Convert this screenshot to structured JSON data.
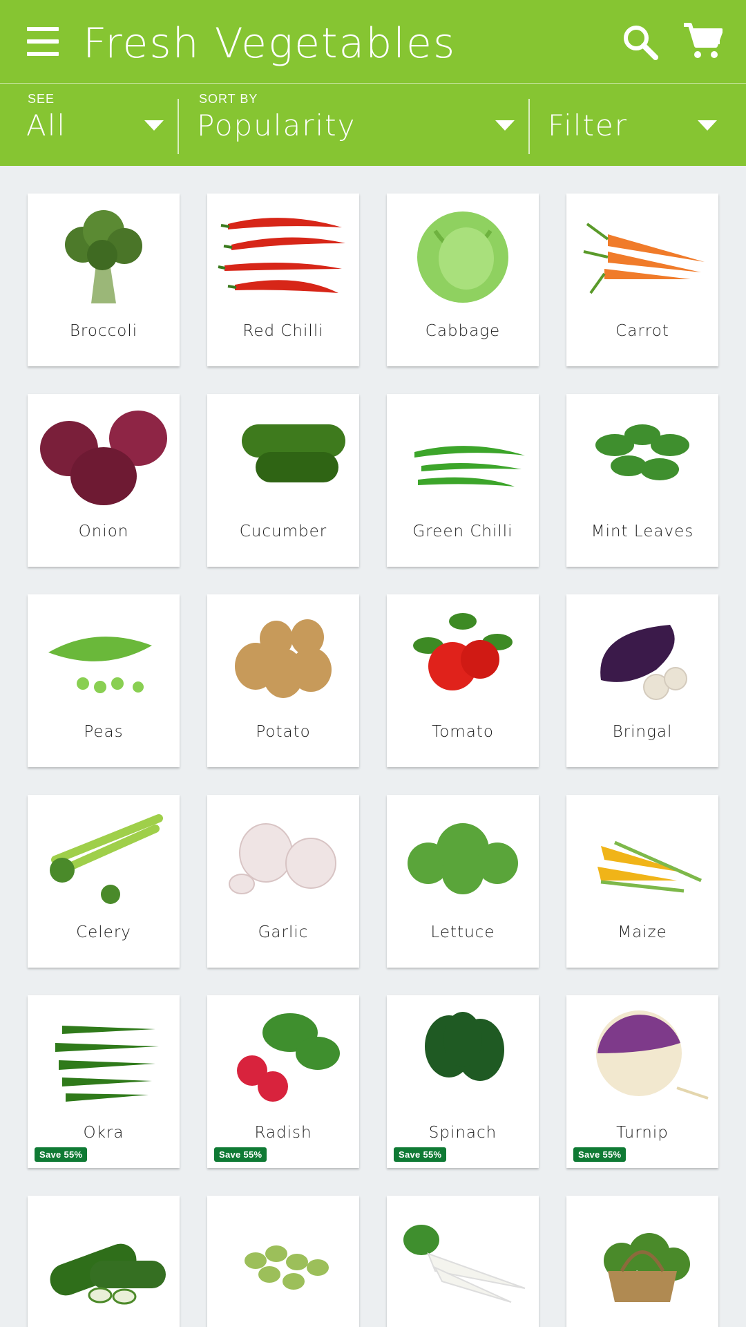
{
  "app_bar": {
    "title": "Fresh Vegetables",
    "icons": [
      "menu-icon",
      "search-icon",
      "cart-icon"
    ],
    "background": "#86c532"
  },
  "filters": {
    "see": {
      "label": "SEE",
      "value": "All"
    },
    "sort": {
      "label": "SORT BY",
      "value": "Popularity"
    },
    "filter": {
      "value": "Filter"
    }
  },
  "products": [
    {
      "name": "Broccoli",
      "badge": ""
    },
    {
      "name": "Red Chilli",
      "badge": ""
    },
    {
      "name": "Cabbage",
      "badge": ""
    },
    {
      "name": "Carrot",
      "badge": ""
    },
    {
      "name": "Onion",
      "badge": ""
    },
    {
      "name": "Cucumber",
      "badge": ""
    },
    {
      "name": "Green Chilli",
      "badge": ""
    },
    {
      "name": "Mint Leaves",
      "badge": ""
    },
    {
      "name": "Peas",
      "badge": ""
    },
    {
      "name": "Potato",
      "badge": ""
    },
    {
      "name": "Tomato",
      "badge": ""
    },
    {
      "name": "Bringal",
      "badge": ""
    },
    {
      "name": "Celery",
      "badge": ""
    },
    {
      "name": "Garlic",
      "badge": ""
    },
    {
      "name": "Lettuce",
      "badge": ""
    },
    {
      "name": "Maize",
      "badge": ""
    },
    {
      "name": "Okra",
      "badge": "Save 55%"
    },
    {
      "name": "Radish",
      "badge": "Save 55%"
    },
    {
      "name": "Spinach",
      "badge": "Save 55%"
    },
    {
      "name": "Turnip",
      "badge": "Save 55%"
    },
    {
      "name": "",
      "badge": ""
    },
    {
      "name": "",
      "badge": ""
    },
    {
      "name": "",
      "badge": ""
    },
    {
      "name": "",
      "badge": ""
    }
  ],
  "colors": {
    "accent": "#86c532",
    "badge": "#0f7a34",
    "background": "#eceff1"
  }
}
